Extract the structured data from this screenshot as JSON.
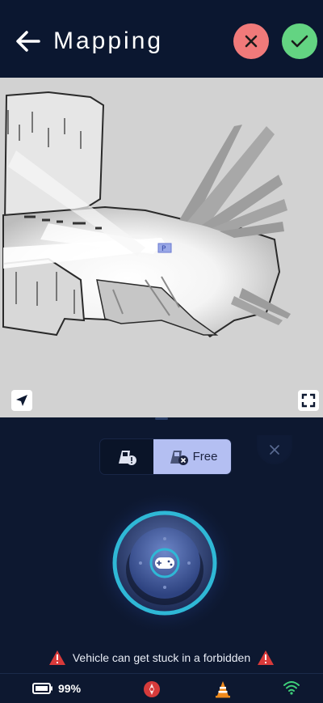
{
  "header": {
    "title": "Mapping",
    "back_icon": "arrow-left-icon",
    "cancel_icon": "close-icon",
    "confirm_icon": "check-icon",
    "colors": {
      "background": "#0b1730",
      "cancel": "#f07a7a",
      "confirm": "#63d482"
    }
  },
  "map": {
    "marker_label": "P",
    "locate_icon": "navigation-arrow-icon",
    "fullscreen_icon": "fullscreen-icon"
  },
  "zone_selector": {
    "options": [
      {
        "icon": "vehicle-warning-icon",
        "label": "",
        "selected": false
      },
      {
        "icon": "vehicle-blocked-icon",
        "label": "Free",
        "selected": true
      }
    ],
    "close_icon": "close-icon",
    "selected_color": "#b4bff2"
  },
  "joystick": {
    "icon": "gamepad-icon",
    "ring_color": "#2fb8d6"
  },
  "warning": {
    "text": "Vehicle can get stuck in a forbidden",
    "icon": "warning-triangle-icon",
    "color": "#d93a3a"
  },
  "status": {
    "battery_label": "99%",
    "battery_icon": "battery-icon",
    "compass_icon": "compass-icon",
    "cone_icon": "traffic-cone-icon",
    "wifi_icon": "wifi-icon"
  }
}
